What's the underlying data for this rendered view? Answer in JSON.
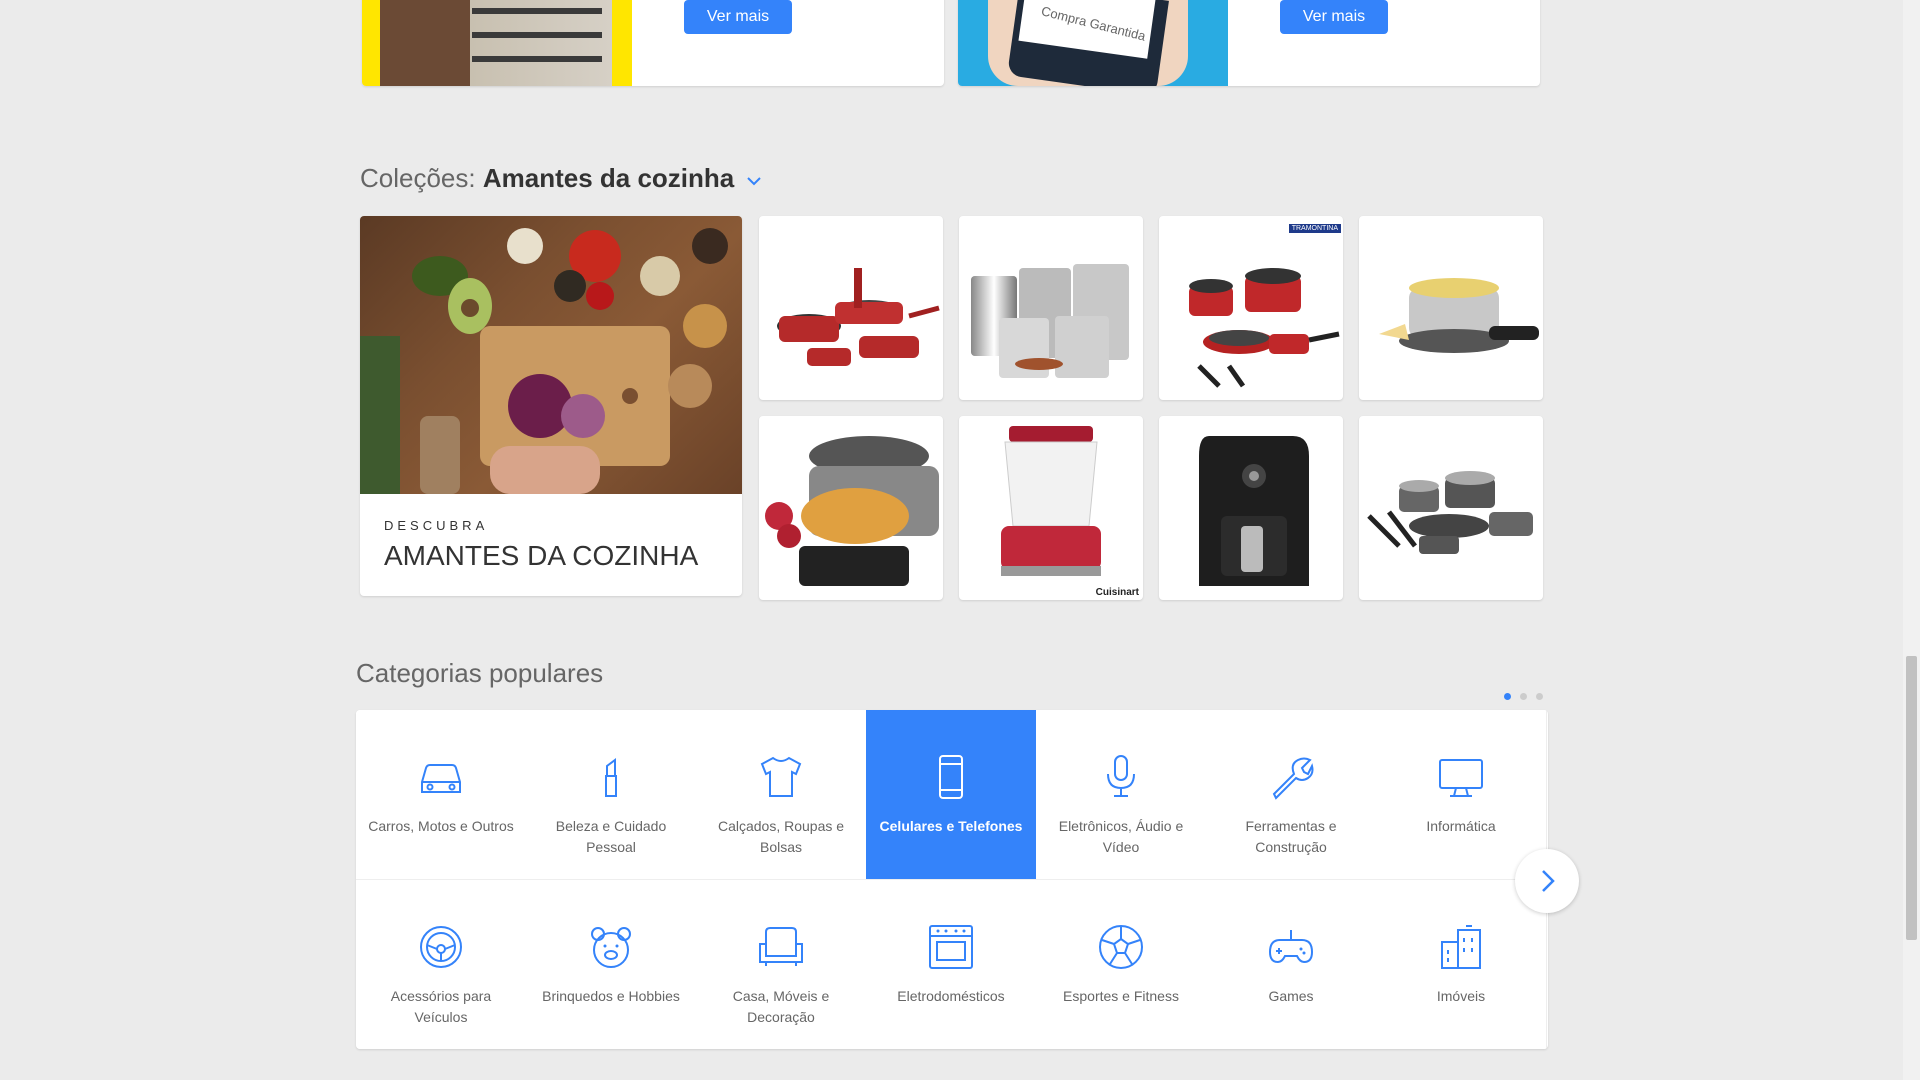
{
  "promos": [
    {
      "button_label": "Ver mais",
      "screen_text": "Compra Garantida"
    },
    {
      "button_label": "Ver mais"
    }
  ],
  "collection": {
    "prefix": "Coleções:",
    "name": "Amantes da cozinha",
    "hero_kicker": "DESCUBRA",
    "hero_title": "AMANTES DA COZINHA",
    "brand_badges": [
      "TRAMONTINA",
      "Cuisinart"
    ]
  },
  "categories": {
    "title": "Categorias populares",
    "items": [
      {
        "label": "Carros, Motos e Outros",
        "icon": "car-icon"
      },
      {
        "label": "Beleza e Cuidado Pessoal",
        "icon": "lipstick-icon"
      },
      {
        "label": "Calçados, Roupas e Bolsas",
        "icon": "tshirt-icon"
      },
      {
        "label": "Celulares e Telefones",
        "icon": "phone-icon",
        "active": true
      },
      {
        "label": "Eletrônicos, Áudio e Vídeo",
        "icon": "microphone-icon"
      },
      {
        "label": "Ferramentas e Construção",
        "icon": "wrench-icon"
      },
      {
        "label": "Informática",
        "icon": "monitor-icon"
      },
      {
        "label": "Acessórios para Veículos",
        "icon": "steering-wheel-icon"
      },
      {
        "label": "Brinquedos e Hobbies",
        "icon": "teddy-bear-icon"
      },
      {
        "label": "Casa, Móveis e Decoração",
        "icon": "armchair-icon"
      },
      {
        "label": "Eletrodomésticos",
        "icon": "oven-icon"
      },
      {
        "label": "Esportes e Fitness",
        "icon": "soccer-ball-icon"
      },
      {
        "label": "Games",
        "icon": "gamepad-icon"
      },
      {
        "label": "Imóveis",
        "icon": "buildings-icon"
      }
    ]
  },
  "colors": {
    "accent": "#3483fa",
    "background": "#ebebeb"
  }
}
